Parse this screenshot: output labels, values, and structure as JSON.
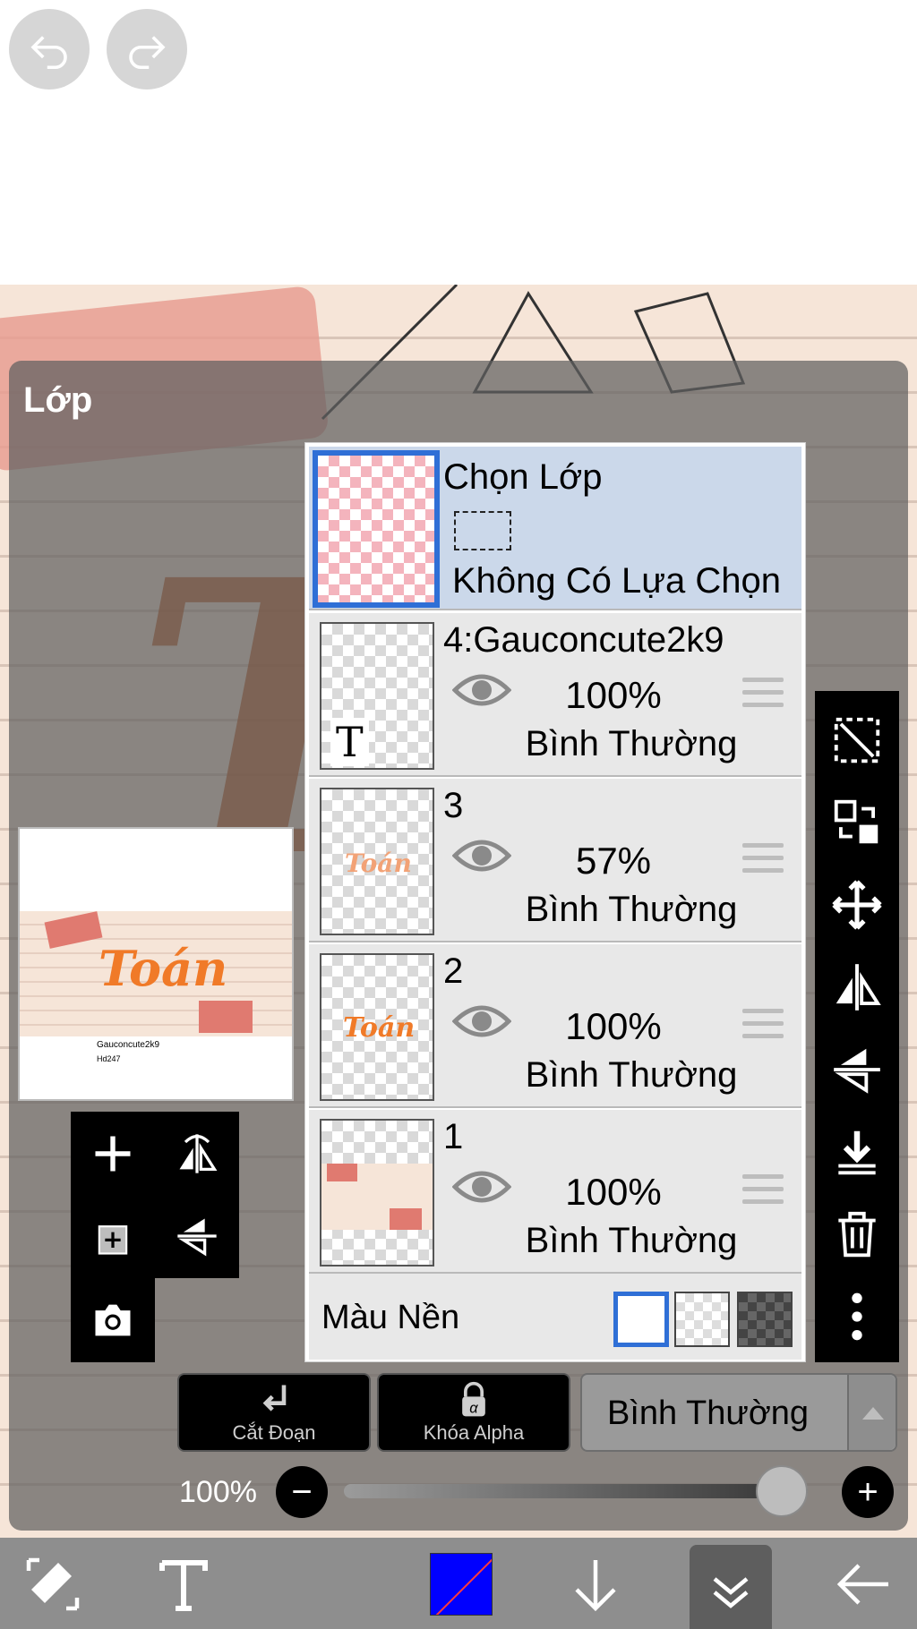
{
  "panel": {
    "title": "Lớp"
  },
  "selection_layer": {
    "title": "Chọn Lớp",
    "status": "Không Có Lựa Chọn"
  },
  "layers": [
    {
      "name": "4:Gauconcute2k9",
      "opacity": "100%",
      "blend": "Bình Thường",
      "thumb_glyph": "T"
    },
    {
      "name": "3",
      "opacity": "57%",
      "blend": "Bình Thường",
      "thumb_text": "Toán"
    },
    {
      "name": "2",
      "opacity": "100%",
      "blend": "Bình Thường",
      "thumb_text": "Toán"
    },
    {
      "name": "1",
      "opacity": "100%",
      "blend": "Bình Thường"
    }
  ],
  "background_color": {
    "label": "Màu Nền",
    "options": [
      "white",
      "transparent",
      "dark-checker"
    ],
    "selected": "white"
  },
  "actions": {
    "clip_label": "Cắt Đoạn",
    "alpha_lock_label": "Khóa Alpha"
  },
  "blend_mode": {
    "value": "Bình Thường"
  },
  "opacity_slider": {
    "label": "100%",
    "value": 1.0
  },
  "preview": {
    "word": "Toán",
    "caption_1": "Gauconcute2k9",
    "caption_2": "Hd247"
  },
  "canvas": {
    "big_letter": "T"
  },
  "colors": {
    "accent": "#2f6fd6",
    "current_color": "#0000ff",
    "panel_overlay": "#5f5f5f"
  },
  "icons": {
    "top": [
      "undo-icon",
      "redo-icon"
    ],
    "right_toolbar": [
      "select-icon",
      "transform-icon",
      "move-icon",
      "flip-horizontal-icon",
      "flip-vertical-icon",
      "merge-down-icon",
      "delete-icon",
      "more-icon"
    ],
    "left_toolbar": [
      "add-layer-icon",
      "flip-layer-icon",
      "add-copy-icon",
      "rotate-layer-icon",
      "camera-icon"
    ],
    "bottom_bar": [
      "eraser-transform-icon",
      "text-tool-icon",
      "color-swatch",
      "down-arrow-icon",
      "collapse-icon",
      "back-arrow-icon"
    ]
  }
}
